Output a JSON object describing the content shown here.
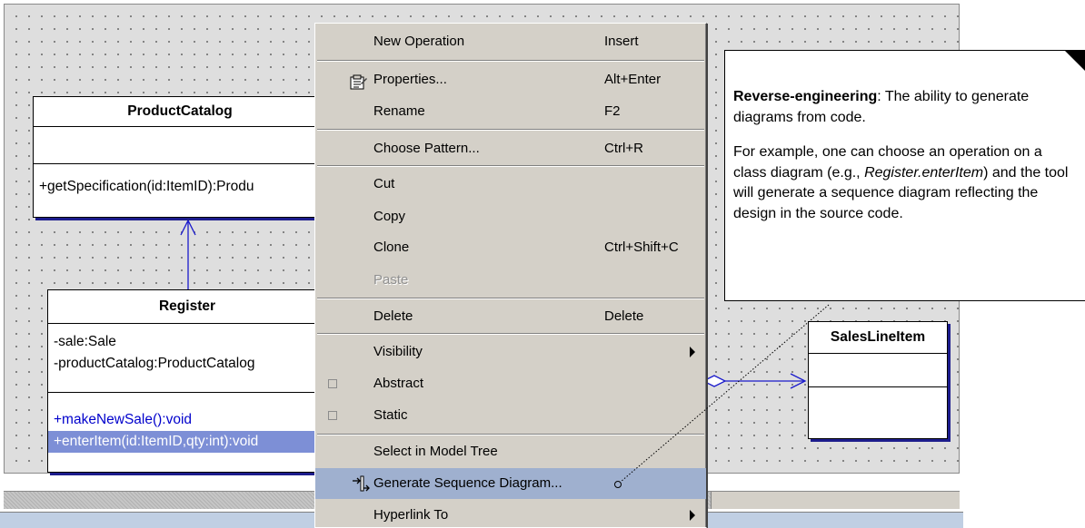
{
  "diagram": {
    "product_catalog": {
      "name": "ProductCatalog",
      "operations": [
        "+getSpecification(id:ItemID):Produ"
      ]
    },
    "register": {
      "name": "Register",
      "attributes": [
        "-sale:Sale",
        "-productCatalog:ProductCatalog"
      ],
      "operations": [
        "+makeNewSale():void",
        "+enterItem(id:ItemID,qty:int):void"
      ]
    },
    "sales_line_item": {
      "name": "SalesLineItem"
    }
  },
  "context_menu": {
    "items": [
      {
        "label": "New Operation",
        "shortcut": "Insert"
      },
      {
        "label": "Properties...",
        "shortcut": "Alt+Enter",
        "icon": "properties-icon"
      },
      {
        "label": "Rename",
        "shortcut": "F2"
      },
      {
        "label": "Choose Pattern...",
        "shortcut": "Ctrl+R"
      },
      {
        "label": "Cut",
        "shortcut": ""
      },
      {
        "label": "Copy",
        "shortcut": ""
      },
      {
        "label": "Clone",
        "shortcut": "Ctrl+Shift+C"
      },
      {
        "label": "Paste",
        "shortcut": "",
        "disabled": true
      },
      {
        "label": "Delete",
        "shortcut": "Delete"
      },
      {
        "label": "Visibility",
        "submenu": true
      },
      {
        "label": "Abstract",
        "checkbox": true,
        "checked": false
      },
      {
        "label": "Static",
        "checkbox": true,
        "checked": false
      },
      {
        "label": "Select in Model Tree"
      },
      {
        "label": "Generate Sequence Diagram...",
        "highlighted": true,
        "icon": "generate-sequence-icon"
      },
      {
        "label": "Hyperlink To",
        "submenu": true
      }
    ]
  },
  "callout": {
    "term": "Reverse-engineering",
    "definition": ": The ability to generate diagrams from code.",
    "example_before": "For example, one can choose an operation on a class diagram (e.g., ",
    "example_italic": "Register.enterItem",
    "example_after": ") and the tool will generate a sequence diagram reflecting the design in the source code."
  },
  "colors": {
    "canvas": "#dedede",
    "menu": "#d4d0c8",
    "menu_highlight": "#9fb0cf",
    "selected_operation": "#7d8fd6",
    "operation_text": "#0000cc",
    "shadow": "#1c1c8c"
  }
}
